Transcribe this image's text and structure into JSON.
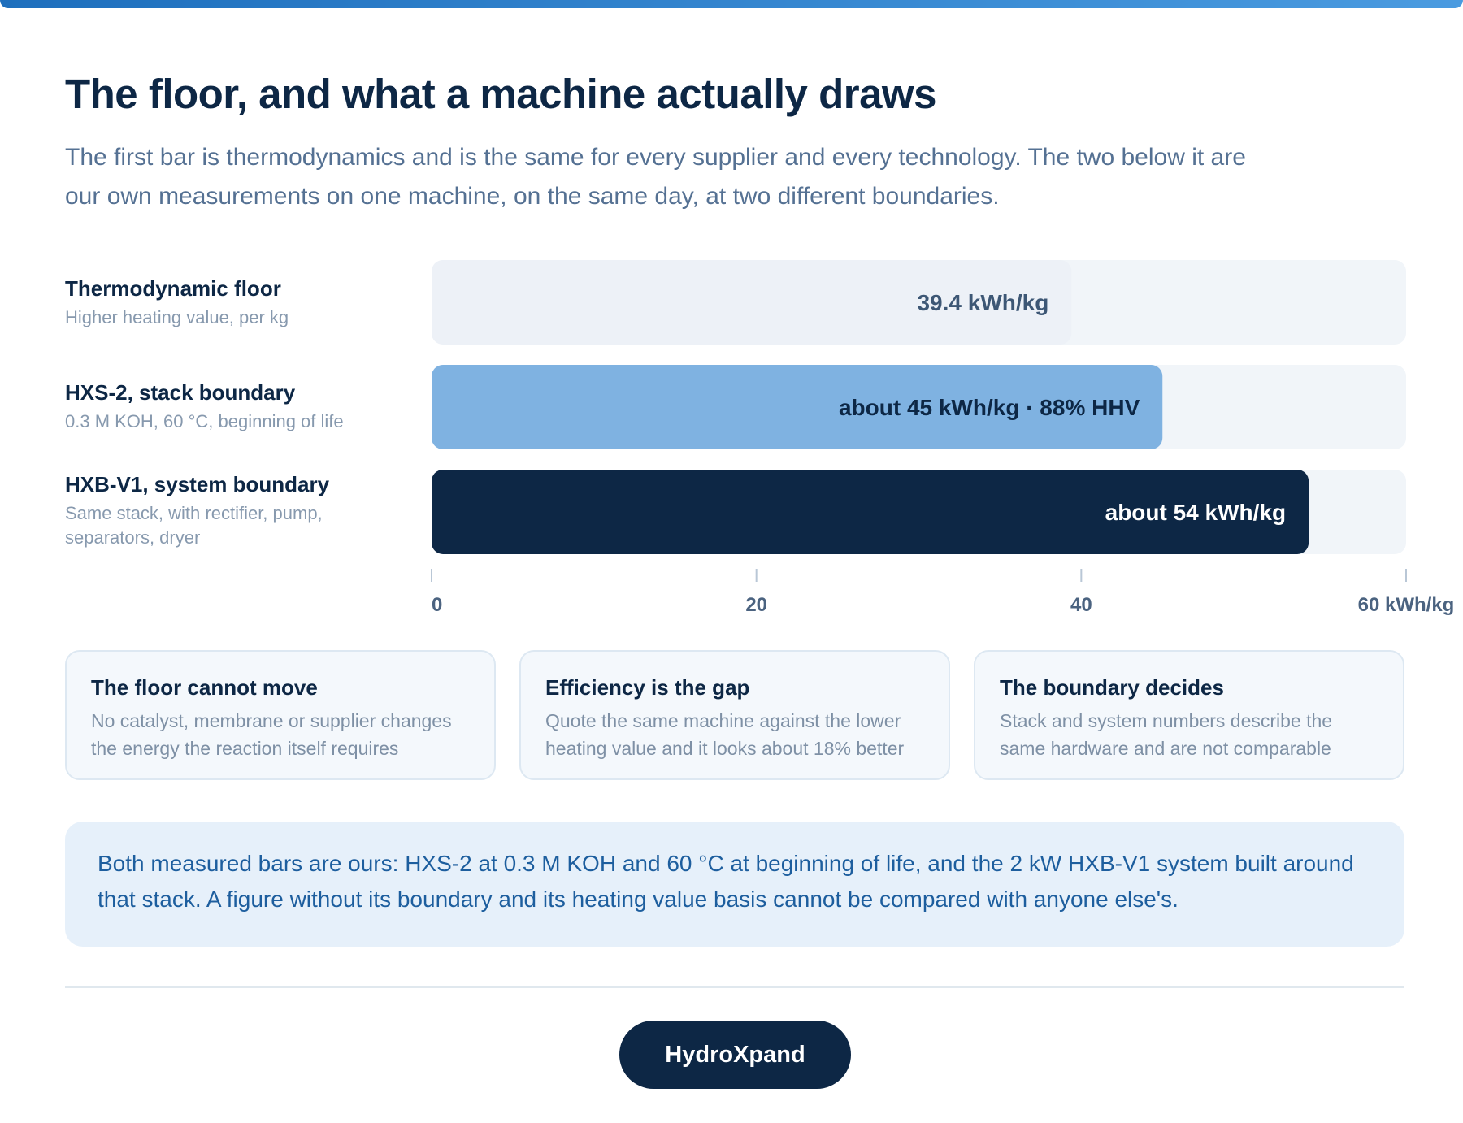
{
  "header": {
    "title": "The floor, and what a machine actually draws",
    "subtitle": "The first bar is thermodynamics and is the same for every supplier and every technology. The two below it are our own measurements on one machine, on the same day, at two different boundaries."
  },
  "chart_data": {
    "type": "bar",
    "orientation": "horizontal",
    "categories": [
      "Thermodynamic floor",
      "HXS-2, stack boundary",
      "HXB-V1, system boundary"
    ],
    "category_notes": [
      "Higher heating value, per kg",
      "0.3 M KOH, 60 °C, beginning of life",
      "Same stack, with rectifier, pump, separators, dryer"
    ],
    "values": [
      39.4,
      45,
      54
    ],
    "value_labels": [
      "39.4 kWh/kg",
      "about 45 kWh/kg · 88% HHV",
      "about 54 kWh/kg"
    ],
    "colors": [
      "#edf1f7",
      "#7fb2e1",
      "#0d2745"
    ],
    "label_colors": [
      "#3d5775",
      "#0d2745",
      "#ffffff"
    ],
    "track_color": "#f1f5f9",
    "xlim": [
      0,
      60
    ],
    "xticks": [
      0,
      20,
      40,
      60
    ],
    "xtick_labels": [
      "0",
      "20",
      "40",
      "60 kWh/kg"
    ],
    "grid": false,
    "legend": "none"
  },
  "insights": [
    {
      "title": "The floor cannot move",
      "body": "No catalyst, membrane or supplier changes the energy the reaction itself requires"
    },
    {
      "title": "Efficiency is the gap",
      "body": "Quote the same machine against the lower heating value and it looks about 18% better"
    },
    {
      "title": "The boundary decides",
      "body": "Stack and system numbers describe the same hardware and are not comparable"
    }
  ],
  "footnote": "Both measured bars are ours: HXS-2 at 0.3 M KOH and 60 °C at beginning of life, and the 2 kW HXB-V1 system built around that stack. A figure without its boundary and its heating value basis cannot be compared with anyone else's.",
  "footer": {
    "button_label": "HydroXpand"
  }
}
